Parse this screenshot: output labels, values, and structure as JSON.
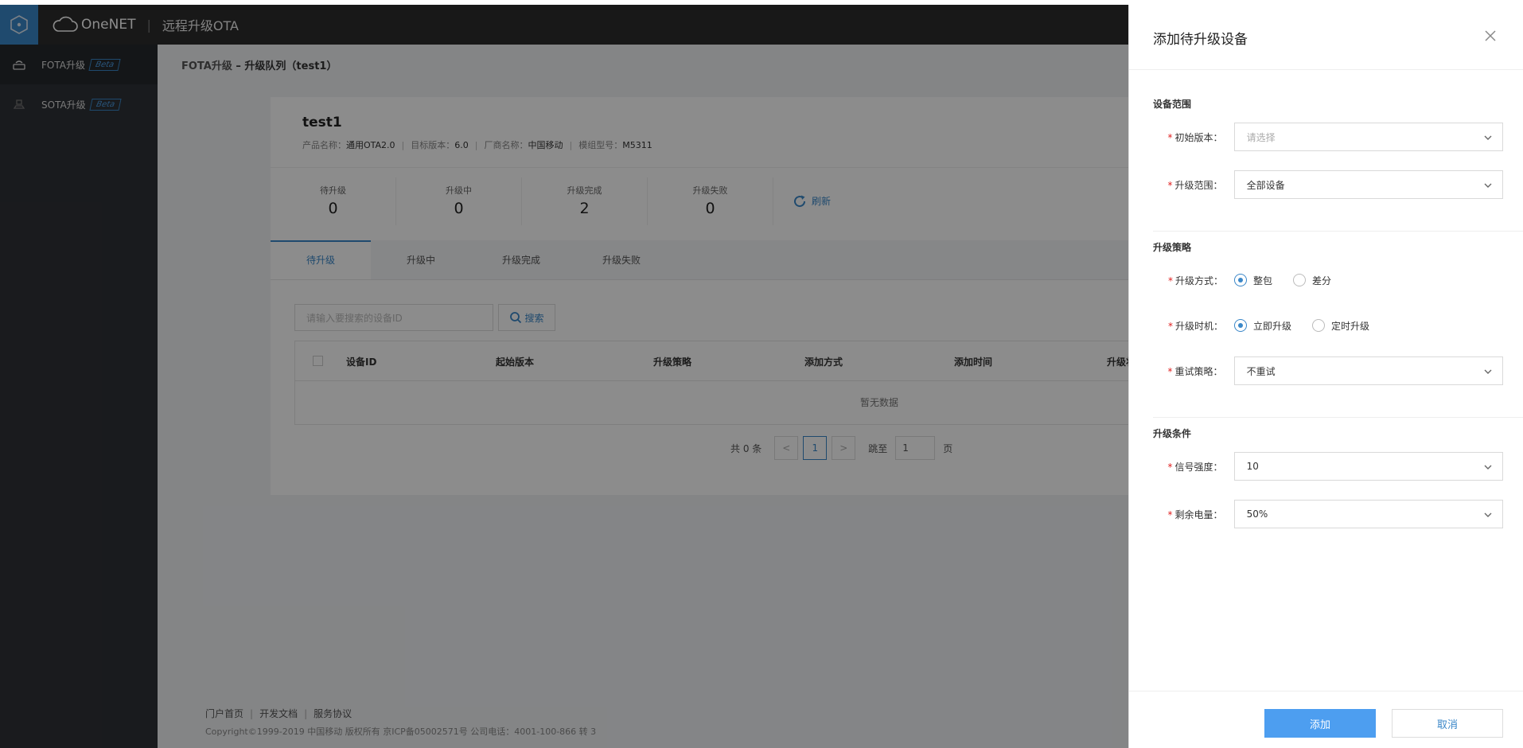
{
  "header": {
    "brand": "OneNET",
    "product": "远程升级OTA"
  },
  "sidebar": {
    "items": [
      {
        "label": "FOTA升级",
        "badge": "Beta"
      },
      {
        "label": "SOTA升级",
        "badge": "Beta"
      }
    ]
  },
  "breadcrumb": {
    "root": "FOTA升级",
    "separator": " – ",
    "current": "升级队列（test1）"
  },
  "product": {
    "name": "test1",
    "meta": [
      {
        "label": "产品名称：",
        "value": "通用OTA2.0"
      },
      {
        "label": "目标版本：",
        "value": "6.0"
      },
      {
        "label": "厂商名称：",
        "value": "中国移动"
      },
      {
        "label": "模组型号：",
        "value": "M5311"
      }
    ]
  },
  "stats": [
    {
      "label": "待升级",
      "value": "0"
    },
    {
      "label": "升级中",
      "value": "0"
    },
    {
      "label": "升级完成",
      "value": "2"
    },
    {
      "label": "升级失败",
      "value": "0"
    }
  ],
  "refresh_label": "刷新",
  "tabs": [
    "待升级",
    "升级中",
    "升级完成",
    "升级失败"
  ],
  "search": {
    "placeholder": "请输入要搜索的设备ID",
    "button": "搜索"
  },
  "table": {
    "columns": [
      "设备ID",
      "起始版本",
      "升级策略",
      "添加方式",
      "添加时间",
      "升级状"
    ],
    "empty": "暂无数据"
  },
  "pager": {
    "total": "共 0 条",
    "prev": "<",
    "current": "1",
    "next": ">",
    "goto": "跳至",
    "goto_value": "1",
    "page_suffix": "页"
  },
  "footer": {
    "links": [
      "门户首页",
      "开发文档",
      "服务协议"
    ],
    "copyright": "Copyright©1999-2019 中国移动 版权所有 京ICP备05002571号 公司电话：4001-100-866 转 3"
  },
  "drawer": {
    "title": "添加待升级设备",
    "sections": {
      "range": "设备范围",
      "strategy": "升级策略",
      "conditions": "升级条件"
    },
    "fields": {
      "initial_version": {
        "label": "初始版本：",
        "placeholder": "请选择"
      },
      "upgrade_range": {
        "label": "升级范围：",
        "value": "全部设备"
      },
      "upgrade_method": {
        "label": "升级方式：",
        "options": [
          "整包",
          "差分"
        ],
        "selected": "整包"
      },
      "upgrade_timing": {
        "label": "升级时机：",
        "options": [
          "立即升级",
          "定时升级"
        ],
        "selected": "立即升级"
      },
      "retry_policy": {
        "label": "重试策略：",
        "value": "不重试"
      },
      "signal_strength": {
        "label": "信号强度：",
        "value": "10"
      },
      "battery_level": {
        "label": "剩余电量：",
        "value": "50%"
      }
    },
    "required_mark": "*",
    "add_button": "添加",
    "cancel_button": "取消"
  },
  "colors": {
    "accent": "#3a87c8",
    "header_bg": "#2d2d2d",
    "sidebar_bg": "#2f3237",
    "primary_button": "#4d9ef0",
    "required": "#e02020"
  }
}
